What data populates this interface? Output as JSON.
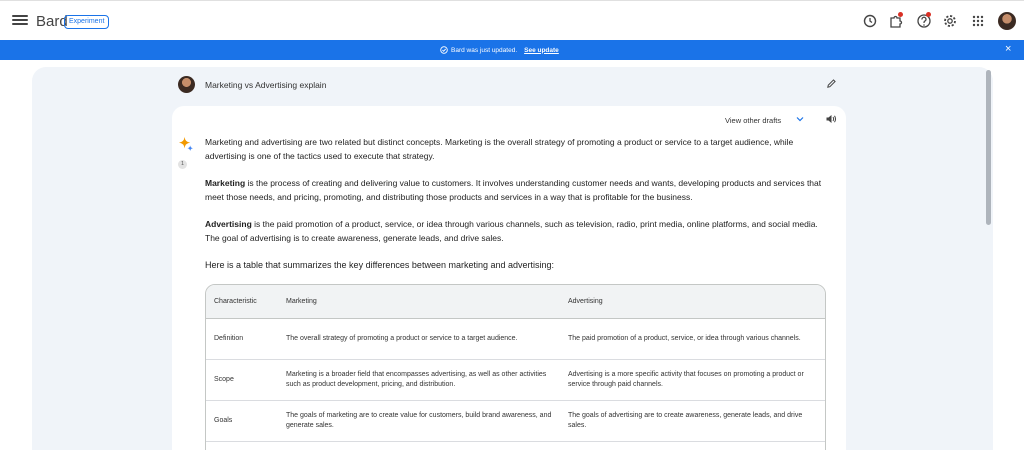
{
  "app": {
    "name": "Bard",
    "badge": "Experiment"
  },
  "topbar_icons": [
    "history-icon",
    "extensions-icon",
    "help-icon",
    "settings-icon",
    "apps-grid-icon"
  ],
  "banner": {
    "text": "Bard was just updated.",
    "link": "See update"
  },
  "prompt": {
    "text": "Marketing vs Advertising explain"
  },
  "response_header": {
    "drafts_label": "View other drafts"
  },
  "response": {
    "draft_number": "1",
    "p1": "Marketing and advertising are two related but distinct concepts. Marketing is the overall strategy of promoting a product or service to a target audience, while advertising is one of the tactics used to execute that strategy.",
    "p2_bold": "Marketing",
    "p2_rest": " is the process of creating and delivering value to customers. It involves understanding customer needs and wants, developing products and services that meet those needs, and pricing, promoting, and distributing those products and services in a way that is profitable for the business.",
    "p3_bold": "Advertising",
    "p3_rest": " is the paid promotion of a product, service, or idea through various channels, such as television, radio, print media, online platforms, and social media. The goal of advertising is to create awareness, generate leads, and drive sales.",
    "p4": "Here is a table that summarizes the key differences between marketing and advertising:"
  },
  "table": {
    "headers": [
      "Characteristic",
      "Marketing",
      "Advertising"
    ],
    "rows": [
      [
        "Definition",
        "The overall strategy of promoting a product or service to a target audience.",
        "The paid promotion of a product, service, or idea through various channels."
      ],
      [
        "Scope",
        "Marketing is a broader field that encompasses advertising, as well as other activities such as product development, pricing, and distribution.",
        "Advertising is a more specific activity that focuses on promoting a product or service through paid channels."
      ],
      [
        "Goals",
        "The goals of marketing are to create value for customers, build brand awareness, and generate sales.",
        "The goals of advertising are to create awareness, generate leads, and drive sales."
      ]
    ]
  },
  "colors": {
    "accent": "#1a73e8",
    "background": "#f0f4f9",
    "sparkle_blue": "#4285f4",
    "sparkle_orange": "#f29900"
  }
}
